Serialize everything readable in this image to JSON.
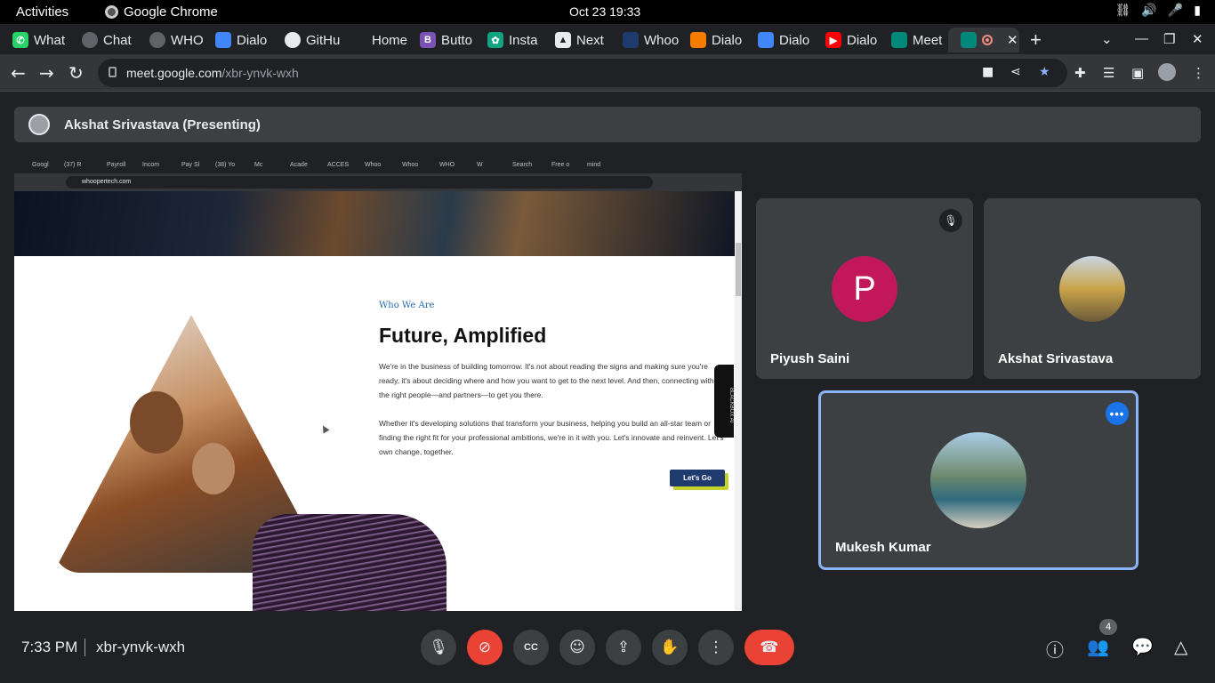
{
  "os_bar": {
    "activities": "Activities",
    "app": "Google Chrome",
    "clock": "Oct 23  19:33"
  },
  "tabs": [
    {
      "label": "What",
      "icon": "whatsapp-icon",
      "color": "#25d366"
    },
    {
      "label": "Chat",
      "icon": "globe-icon",
      "color": "#5f6368"
    },
    {
      "label": "WHO",
      "icon": "globe-icon",
      "color": "#5f6368"
    },
    {
      "label": "Dialo",
      "icon": "google-cloud-icon",
      "color": "#4285f4"
    },
    {
      "label": "GitHu",
      "icon": "github-icon",
      "color": "#000000"
    },
    {
      "label": "Home",
      "icon": "blank-icon",
      "color": "#202124"
    },
    {
      "label": "Butto",
      "icon": "bootstrap-icon",
      "color": "#7952b3"
    },
    {
      "label": "Insta",
      "icon": "openai-icon",
      "color": "#10a37f"
    },
    {
      "label": "Next",
      "icon": "next-icon",
      "color": "#ffffff"
    },
    {
      "label": "Whoo",
      "icon": "whoop-icon",
      "color": "#1f3b6e"
    },
    {
      "label": "Dialo",
      "icon": "hexagon-icon",
      "color": "#f57c00"
    },
    {
      "label": "Dialo",
      "icon": "cube-icon",
      "color": "#4285f4"
    },
    {
      "label": "Dialo",
      "icon": "youtube-icon",
      "color": "#ff0000"
    },
    {
      "label": "Meet",
      "icon": "meet-icon",
      "color": "#00897b"
    }
  ],
  "active_tab": {
    "icon": "meet-icon",
    "close": "✕"
  },
  "url": {
    "host": "meet.google.com",
    "path": "/xbr-ynvk-wxh"
  },
  "presenter": {
    "label": "Akshat Srivastava (Presenting)"
  },
  "shared_screen": {
    "inner_url": "whoopertech.com",
    "inner_tabs": [
      "Googl",
      "(37) R",
      "Payroll",
      "Incom",
      "Pay Sl",
      "(38) Yo",
      "Mc",
      "Acade",
      "ACCES",
      "Whoo",
      "Whoo",
      "WHO",
      "W",
      "Search",
      "Free o",
      "mind"
    ],
    "eyebrow": "Who We Are",
    "heading": "Future, Amplified",
    "para1": "We're in the business of building tomorrow. It's not about reading the signs and making sure you're ready, it's about deciding where and how you want to get to the next level. And then, connecting with the right people—and partners—to get you there.",
    "para2": "Whether it's developing solutions that transform your business, helping you build an all-star team or finding the right fit for your professional ambitions, we're in it with you. Let's innovate and reinvent. Let's own change, together.",
    "cta": "Let's Go",
    "side_widget": "BLACKBOX AI"
  },
  "participants": [
    {
      "name": "Piyush Saini",
      "initial": "P",
      "muted": true
    },
    {
      "name": "Akshat Srivastava",
      "initial": ""
    },
    {
      "name": "Mukesh Kumar",
      "initial": ""
    }
  ],
  "bottom": {
    "time": "7:33 PM",
    "meeting_code": "xbr-ynvk-wxh",
    "people_count": "4"
  }
}
